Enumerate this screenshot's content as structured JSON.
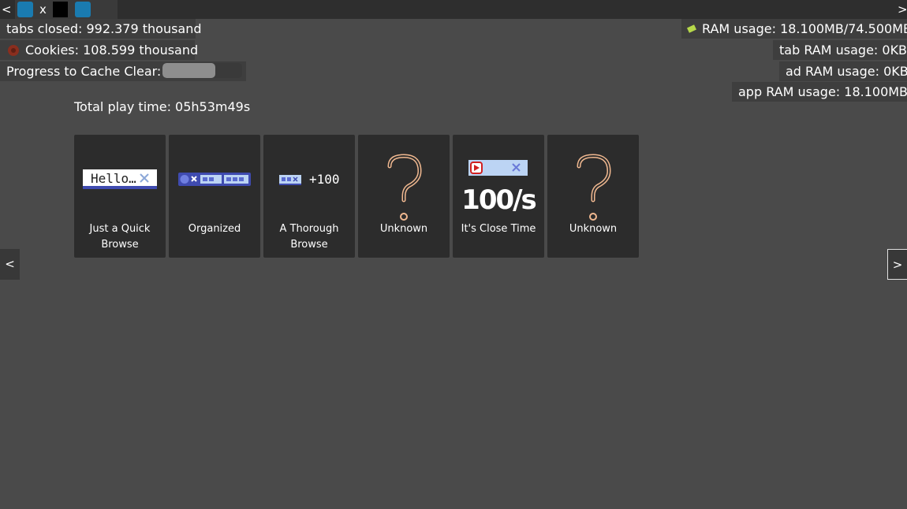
{
  "topbar": {
    "left_arrow": "<",
    "right_arrow": ">",
    "tab_close": "x"
  },
  "stats_left": {
    "tabs_closed": "tabs closed: 992.379 thousand",
    "cookies": "Cookies: 108.599 thousand",
    "progress_label": "Progress to Cache Clear:",
    "progress_fraction": 0.66
  },
  "stats_right": {
    "ram_usage": "RAM usage: 18.100MB/74.500MB",
    "tab_ram": "tab RAM usage: 0KB",
    "ad_ram": "ad RAM usage: 0KB",
    "app_ram": "app RAM usage: 18.100MB"
  },
  "playtime": "Total play time: 05h53m49s",
  "achievements": [
    {
      "label": "Just a Quick Browse",
      "icon": "hello-tab-icon"
    },
    {
      "label": "Organized",
      "icon": "organized-tabs-icon"
    },
    {
      "label": "A Thorough Browse",
      "icon": "tab-plus-100-icon",
      "icon_text": "+100"
    },
    {
      "label": "Unknown",
      "icon": "question-mark-icon"
    },
    {
      "label": "It's Close Time",
      "icon": "close-rate-icon",
      "icon_text": "100/s"
    },
    {
      "label": "Unknown",
      "icon": "question-mark-icon"
    }
  ],
  "hello_text": "Hello…",
  "nav": {
    "prev": "<",
    "next": ">"
  },
  "colors": {
    "background": "#4a4a4a",
    "card": "#2c2c2c",
    "topbar": "#2e2e2e",
    "mini_tab_blue": "#1a7bb0",
    "question_mark": "#f0b890",
    "tab_fill": "#bcd4f4",
    "tab_blue_dark": "#3f4bb0"
  }
}
